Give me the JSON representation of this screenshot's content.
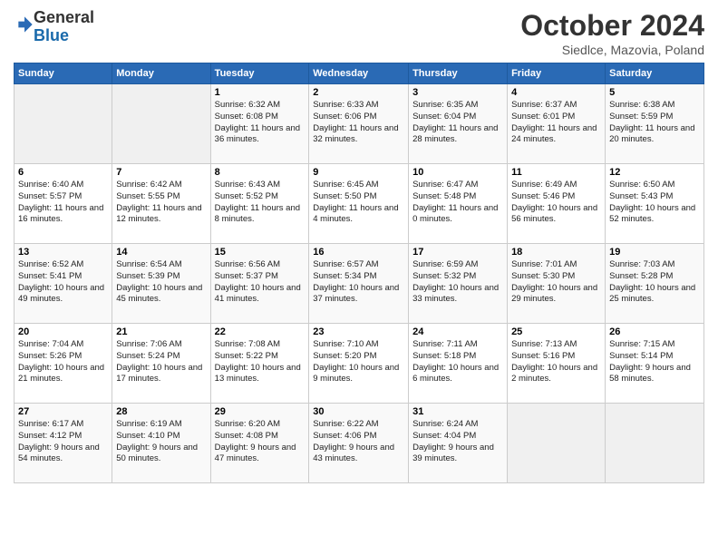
{
  "logo": {
    "general": "General",
    "blue": "Blue"
  },
  "header": {
    "month": "October 2024",
    "location": "Siedlce, Mazovia, Poland"
  },
  "weekdays": [
    "Sunday",
    "Monday",
    "Tuesday",
    "Wednesday",
    "Thursday",
    "Friday",
    "Saturday"
  ],
  "weeks": [
    [
      {
        "day": "",
        "empty": true
      },
      {
        "day": "",
        "empty": true
      },
      {
        "day": "1",
        "sunrise": "6:32 AM",
        "sunset": "6:08 PM",
        "daylight": "11 hours and 36 minutes."
      },
      {
        "day": "2",
        "sunrise": "6:33 AM",
        "sunset": "6:06 PM",
        "daylight": "11 hours and 32 minutes."
      },
      {
        "day": "3",
        "sunrise": "6:35 AM",
        "sunset": "6:04 PM",
        "daylight": "11 hours and 28 minutes."
      },
      {
        "day": "4",
        "sunrise": "6:37 AM",
        "sunset": "6:01 PM",
        "daylight": "11 hours and 24 minutes."
      },
      {
        "day": "5",
        "sunrise": "6:38 AM",
        "sunset": "5:59 PM",
        "daylight": "11 hours and 20 minutes."
      }
    ],
    [
      {
        "day": "6",
        "sunrise": "6:40 AM",
        "sunset": "5:57 PM",
        "daylight": "11 hours and 16 minutes."
      },
      {
        "day": "7",
        "sunrise": "6:42 AM",
        "sunset": "5:55 PM",
        "daylight": "11 hours and 12 minutes."
      },
      {
        "day": "8",
        "sunrise": "6:43 AM",
        "sunset": "5:52 PM",
        "daylight": "11 hours and 8 minutes."
      },
      {
        "day": "9",
        "sunrise": "6:45 AM",
        "sunset": "5:50 PM",
        "daylight": "11 hours and 4 minutes."
      },
      {
        "day": "10",
        "sunrise": "6:47 AM",
        "sunset": "5:48 PM",
        "daylight": "11 hours and 0 minutes."
      },
      {
        "day": "11",
        "sunrise": "6:49 AM",
        "sunset": "5:46 PM",
        "daylight": "10 hours and 56 minutes."
      },
      {
        "day": "12",
        "sunrise": "6:50 AM",
        "sunset": "5:43 PM",
        "daylight": "10 hours and 52 minutes."
      }
    ],
    [
      {
        "day": "13",
        "sunrise": "6:52 AM",
        "sunset": "5:41 PM",
        "daylight": "10 hours and 49 minutes."
      },
      {
        "day": "14",
        "sunrise": "6:54 AM",
        "sunset": "5:39 PM",
        "daylight": "10 hours and 45 minutes."
      },
      {
        "day": "15",
        "sunrise": "6:56 AM",
        "sunset": "5:37 PM",
        "daylight": "10 hours and 41 minutes."
      },
      {
        "day": "16",
        "sunrise": "6:57 AM",
        "sunset": "5:34 PM",
        "daylight": "10 hours and 37 minutes."
      },
      {
        "day": "17",
        "sunrise": "6:59 AM",
        "sunset": "5:32 PM",
        "daylight": "10 hours and 33 minutes."
      },
      {
        "day": "18",
        "sunrise": "7:01 AM",
        "sunset": "5:30 PM",
        "daylight": "10 hours and 29 minutes."
      },
      {
        "day": "19",
        "sunrise": "7:03 AM",
        "sunset": "5:28 PM",
        "daylight": "10 hours and 25 minutes."
      }
    ],
    [
      {
        "day": "20",
        "sunrise": "7:04 AM",
        "sunset": "5:26 PM",
        "daylight": "10 hours and 21 minutes."
      },
      {
        "day": "21",
        "sunrise": "7:06 AM",
        "sunset": "5:24 PM",
        "daylight": "10 hours and 17 minutes."
      },
      {
        "day": "22",
        "sunrise": "7:08 AM",
        "sunset": "5:22 PM",
        "daylight": "10 hours and 13 minutes."
      },
      {
        "day": "23",
        "sunrise": "7:10 AM",
        "sunset": "5:20 PM",
        "daylight": "10 hours and 9 minutes."
      },
      {
        "day": "24",
        "sunrise": "7:11 AM",
        "sunset": "5:18 PM",
        "daylight": "10 hours and 6 minutes."
      },
      {
        "day": "25",
        "sunrise": "7:13 AM",
        "sunset": "5:16 PM",
        "daylight": "10 hours and 2 minutes."
      },
      {
        "day": "26",
        "sunrise": "7:15 AM",
        "sunset": "5:14 PM",
        "daylight": "9 hours and 58 minutes."
      }
    ],
    [
      {
        "day": "27",
        "sunrise": "6:17 AM",
        "sunset": "4:12 PM",
        "daylight": "9 hours and 54 minutes."
      },
      {
        "day": "28",
        "sunrise": "6:19 AM",
        "sunset": "4:10 PM",
        "daylight": "9 hours and 50 minutes."
      },
      {
        "day": "29",
        "sunrise": "6:20 AM",
        "sunset": "4:08 PM",
        "daylight": "9 hours and 47 minutes."
      },
      {
        "day": "30",
        "sunrise": "6:22 AM",
        "sunset": "4:06 PM",
        "daylight": "9 hours and 43 minutes."
      },
      {
        "day": "31",
        "sunrise": "6:24 AM",
        "sunset": "4:04 PM",
        "daylight": "9 hours and 39 minutes."
      },
      {
        "day": "",
        "empty": true
      },
      {
        "day": "",
        "empty": true
      }
    ]
  ],
  "labels": {
    "sunrise_prefix": "Sunrise: ",
    "sunset_prefix": "Sunset: ",
    "daylight_prefix": "Daylight: "
  }
}
